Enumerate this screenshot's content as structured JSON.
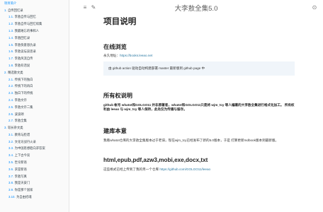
{
  "toc": [
    {
      "level": 1,
      "num": "",
      "label": "项目简介",
      "active": true
    },
    {
      "level": 1,
      "num": "1.",
      "label": "自传回忆录"
    },
    {
      "level": 2,
      "num": "1.1.",
      "label": "李敖自传与回忆"
    },
    {
      "level": 2,
      "num": "1.2.",
      "label": "李敖自传与回忆续集"
    },
    {
      "level": 2,
      "num": "1.3.",
      "label": "我最难忘的事和人"
    },
    {
      "level": 2,
      "num": "1.4.",
      "label": "李敖回忆录"
    },
    {
      "level": 2,
      "num": "1.5.",
      "label": "李敖快意恩仇录"
    },
    {
      "level": 2,
      "num": "1.6.",
      "label": "李敖议坛哀思录"
    },
    {
      "level": 2,
      "num": "1.7.",
      "label": "李敖风流自传"
    },
    {
      "level": 2,
      "num": "1.8.",
      "label": "李敖有话说"
    },
    {
      "level": 1,
      "num": "2.",
      "label": "精选散文类"
    },
    {
      "level": 2,
      "num": "2.1.",
      "label": "传统下的独白"
    },
    {
      "level": 2,
      "num": "2.2.",
      "label": "传统下的再白"
    },
    {
      "level": 2,
      "num": "2.3.",
      "label": "独白下的传统"
    },
    {
      "level": 2,
      "num": "2.4.",
      "label": "李敖文存"
    },
    {
      "level": 2,
      "num": "2.5.",
      "label": "李敖文存二集"
    },
    {
      "level": 2,
      "num": "2.6.",
      "label": "波波颂"
    },
    {
      "level": 2,
      "num": "2.7.",
      "label": "李敖全集"
    },
    {
      "level": 1,
      "num": "3.",
      "label": "较长杂文类"
    },
    {
      "level": 2,
      "num": "3.1.",
      "label": "教育与脸谱"
    },
    {
      "level": 2,
      "num": "3.2.",
      "label": "文化论战丹火录"
    },
    {
      "level": 2,
      "num": "3.3.",
      "label": "为中国思想趋向求答案"
    },
    {
      "level": 2,
      "num": "3.4.",
      "label": "上下古今谈"
    },
    {
      "level": 2,
      "num": "3.5.",
      "label": "世论新语"
    },
    {
      "level": 2,
      "num": "3.6.",
      "label": "求是新语"
    },
    {
      "level": 2,
      "num": "3.7.",
      "label": "李敖写真"
    },
    {
      "level": 2,
      "num": "3.8.",
      "label": "我是天安门"
    },
    {
      "level": 2,
      "num": "3.9.",
      "label": "你是那个国家"
    },
    {
      "level": 2,
      "num": "3.10.",
      "label": "为自由招魂"
    }
  ],
  "menubar": {
    "title": "大李敖全集5.0",
    "sidebar_toggle": "≡",
    "edit_icon": "✎",
    "github_icon": "⊙"
  },
  "content": {
    "page_title": "项目说明",
    "section_online": "在线浏览",
    "permanent_label": "永久地址：",
    "permanent_url": "https://books.leeao.net",
    "note_text": "由 github action 驱动自动构建部署 master 最新版到 github page 中",
    "section_copyright": "所有权说明",
    "copyright_text": "github 帐号 whatot和GOLGO11 并非原著者，whatot和GOLGO11只是将 wjm_tcy 等人编著的大李敖全集进行格式化加工。 所有权利由 leeao 与 wjm_tcy 等人保持，此处仅为传播与留存。",
    "section_origin": "建库本意",
    "origin_text": "我看whatot仓库的大李敖全集版本过于老旧，现在wjm_tcy已经发布了新的5.0版本，于是 打算更新mdbook版本到最新版。",
    "section_formats": "html,epub,pdf,azw3,mobi,exe,docx,txt",
    "formats_text": "这些格式已经上传到了我的另一个仓库",
    "formats_url": "https://github.com/GOLGO11/leeao"
  },
  "colors": {
    "accent": "#008cff",
    "link": "#2b79a2",
    "note_bg": "#f0f5fa",
    "sidebar_bg": "#fafafa"
  }
}
